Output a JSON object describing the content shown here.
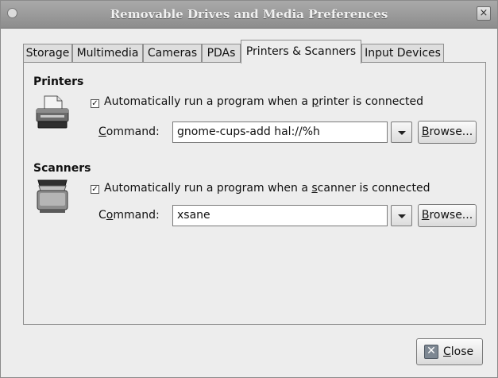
{
  "window": {
    "title": "Removable Drives and Media Preferences",
    "close_glyph": "×"
  },
  "tabs": [
    {
      "label": "Storage",
      "active": false
    },
    {
      "label": "Multimedia",
      "active": false
    },
    {
      "label": "Cameras",
      "active": false
    },
    {
      "label": "PDAs",
      "active": false
    },
    {
      "label": "Printers & Scanners",
      "active": true
    },
    {
      "label": "Input Devices",
      "active": false
    }
  ],
  "printers": {
    "heading": "Printers",
    "icon": "printer-icon",
    "auto_run": {
      "checked": true,
      "label_pre": "Automatically run a program when a ",
      "label_mnemonic": "p",
      "label_post": "rinter is connected"
    },
    "command": {
      "label_mnemonic": "C",
      "label_rest": "ommand:",
      "value": "gnome-cups-add hal://%h"
    },
    "browse": {
      "mnemonic": "B",
      "rest": "rowse..."
    }
  },
  "scanners": {
    "heading": "Scanners",
    "icon": "scanner-icon",
    "auto_run": {
      "checked": true,
      "label_pre": "Automatically run a program when a ",
      "label_mnemonic": "s",
      "label_post": "canner is connected"
    },
    "command": {
      "label_pre": "C",
      "label_mnemonic": "o",
      "label_rest": "mmand:",
      "value": "xsane"
    },
    "browse": {
      "mnemonic": "B",
      "rest": "rowse..."
    }
  },
  "footer": {
    "close_mnemonic": "C",
    "close_rest": "lose"
  },
  "glyphs": {
    "check": "✓",
    "close_icon": "✕"
  }
}
